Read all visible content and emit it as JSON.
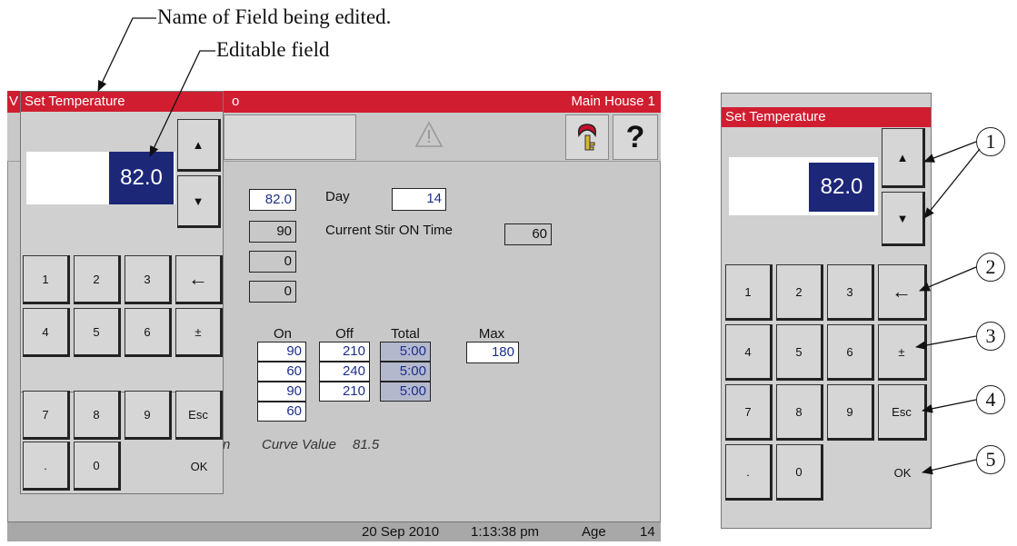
{
  "annotations": {
    "field_name": "Name of Field being edited.",
    "editable_field": "Editable field"
  },
  "screen": {
    "title_left": "V",
    "title_mid": "o",
    "title_right": "Main House 1",
    "warning_icon": "warning-triangle-icon",
    "key_icon": "key-icon",
    "help_label": "?",
    "values": {
      "setpoint": "82.0",
      "v2": "90",
      "v3": "0",
      "v4": "0"
    },
    "day_label": "Day",
    "day_value": "14",
    "stir_label": "Current Stir ON Time",
    "stir_value": "60",
    "schedule": {
      "headers": {
        "on": "On",
        "off": "Off",
        "total": "Total",
        "max": "Max"
      },
      "on": [
        "90",
        "60",
        "90",
        "60"
      ],
      "off": [
        "210",
        "240",
        "210"
      ],
      "total": [
        "5:00",
        "5:00",
        "5:00"
      ],
      "max": "180"
    },
    "curve_label": "Curve Value",
    "curve_value": "81.5",
    "curve_prefix": "n",
    "status": {
      "date": "20 Sep 2010",
      "time": "1:13:38 pm",
      "age_label": "Age",
      "age_value": "14"
    }
  },
  "keypad": {
    "title": "Set Temperature",
    "value": "82.0",
    "up": "▲",
    "down": "▼",
    "keys": [
      "1",
      "2",
      "3",
      "←",
      "4",
      "5",
      "6",
      "±",
      "7",
      "8",
      "9",
      "Esc",
      ".",
      "0",
      "",
      "OK"
    ]
  },
  "callouts": [
    "1",
    "2",
    "3",
    "4",
    "5"
  ]
}
